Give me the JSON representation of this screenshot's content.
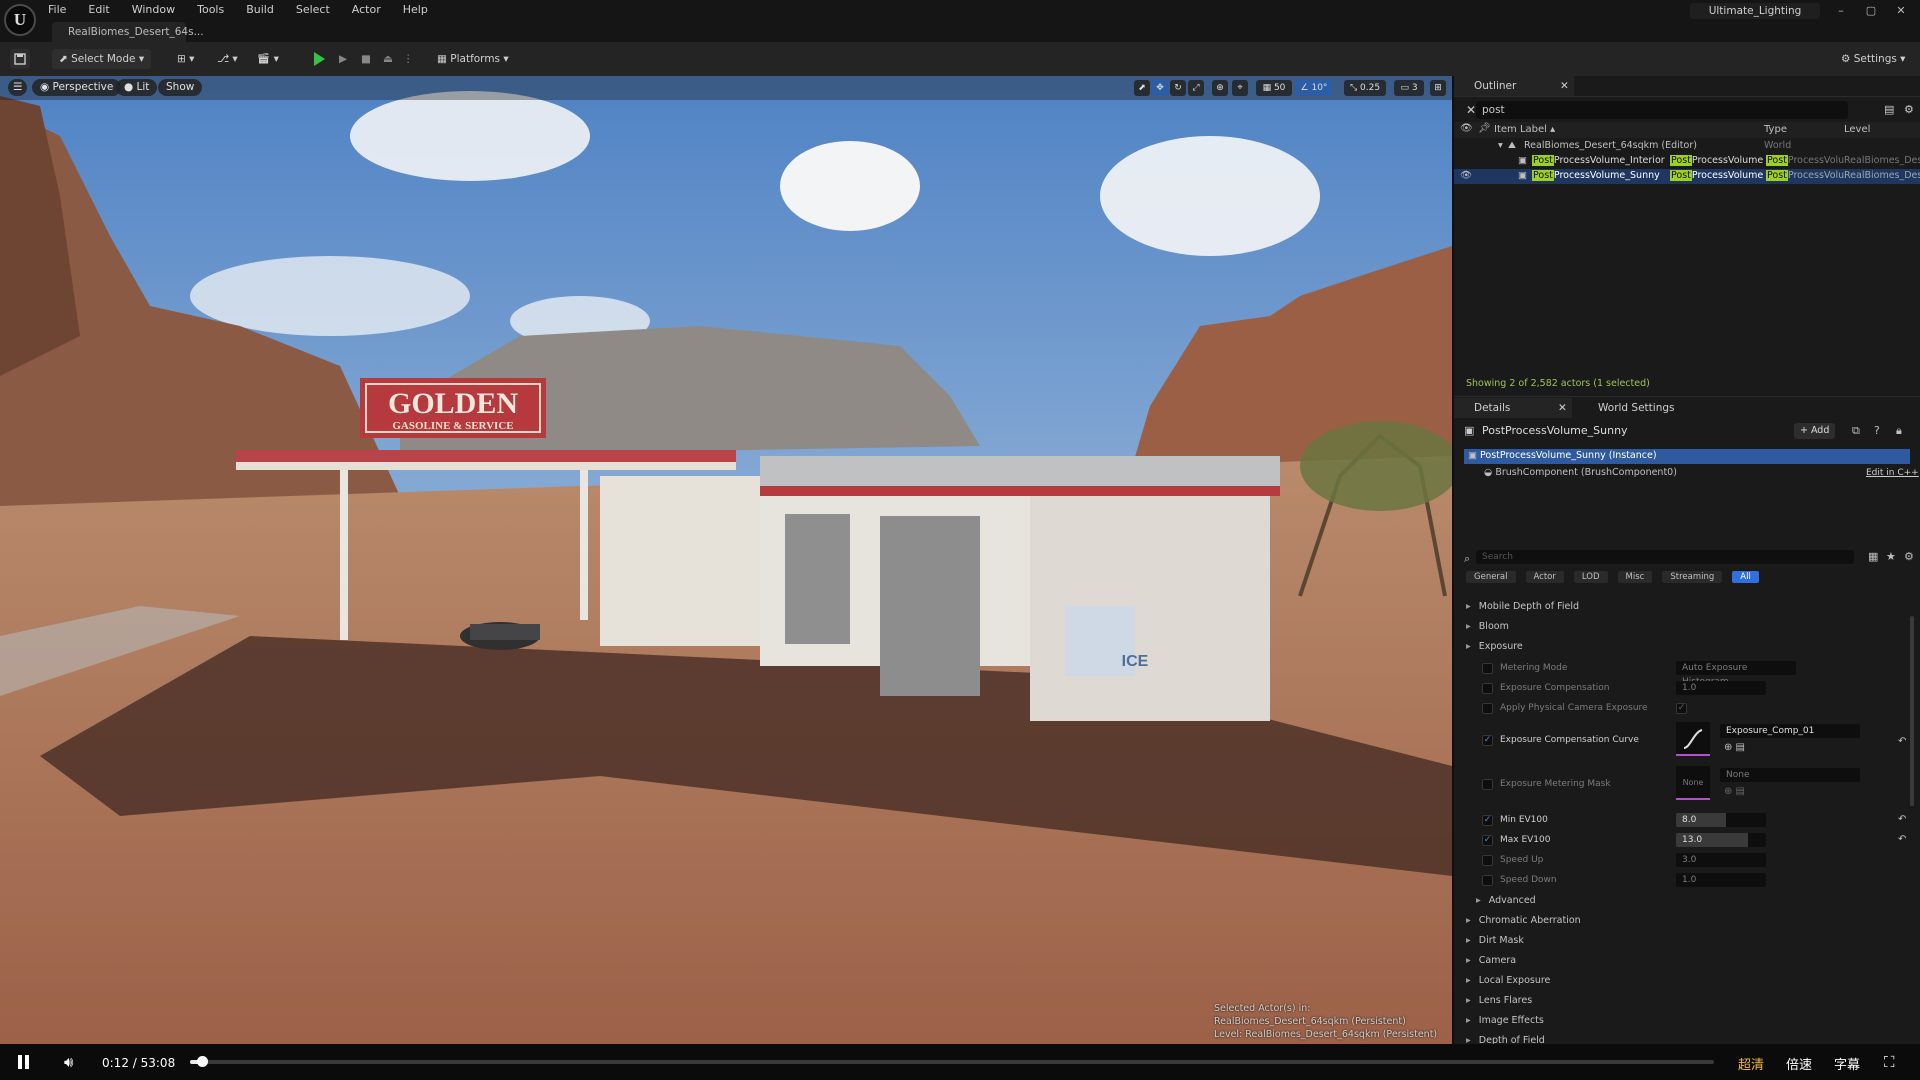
{
  "menu": [
    "File",
    "Edit",
    "Window",
    "Tools",
    "Build",
    "Select",
    "Actor",
    "Help"
  ],
  "doc_tab": "RealBiomes_Desert_64s...",
  "project_name": "Ultimate_Lighting",
  "window_controls": [
    "–",
    "▢",
    "✕"
  ],
  "toolbar": {
    "select_mode": "Select Mode",
    "platforms": "Platforms",
    "settings": "Settings"
  },
  "viewport": {
    "perspective": "Perspective",
    "lit": "Lit",
    "show": "Show",
    "grid_snap": "50",
    "angle_snap": "10°",
    "scale_snap": "0.25",
    "camera_speed": "3",
    "sign_title": "GOLDEN",
    "sign_sub": "GASOLINE & SERVICE",
    "ice_label": "ICE",
    "overlay_line1": "Selected Actor(s) in:",
    "overlay_line2": "RealBiomes_Desert_64sqkm (Persistent)",
    "overlay_line3": "Level: RealBiomes_Desert_64sqkm (Persistent)"
  },
  "outliner": {
    "title": "Outliner",
    "search_value": "post",
    "columns": {
      "label": "Item Label ▴",
      "type": "Type",
      "level": "Level"
    },
    "world": {
      "name": "RealBiomes_Desert_64sqkm (Editor)",
      "type": "World"
    },
    "rows": [
      {
        "hl": "Post",
        "name": "ProcessVolume_Interior",
        "type_hl": "Post",
        "type": "ProcessVolume",
        "type2_hl": "Post",
        "type2": "ProcessVolu",
        "level": "RealBiomes_Des"
      },
      {
        "hl": "Post",
        "name": "ProcessVolume_Sunny",
        "type_hl": "Post",
        "type": "ProcessVolume",
        "type2_hl": "Post",
        "type2": "ProcessVolu",
        "level": "RealBiomes_Des"
      }
    ],
    "status": "Showing 2 of 2,582 actors (1 selected)"
  },
  "details": {
    "tab": "Details",
    "world_settings_tab": "World Settings",
    "actor_name": "PostProcessVolume_Sunny",
    "add_button": "+ Add",
    "instance": "PostProcessVolume_Sunny (Instance)",
    "brush": "BrushComponent (BrushComponent0)",
    "edit_cpp": "Edit in C++",
    "search_placeholder": "Search",
    "filter_tabs": [
      "General",
      "Actor",
      "LOD",
      "Misc",
      "Streaming",
      "All"
    ],
    "categories_top": [
      "Mobile Depth of Field",
      "Bloom",
      "Exposure"
    ],
    "metering_mode": {
      "label": "Metering Mode",
      "value": "Auto Exposure Histogram"
    },
    "exposure_compensation": {
      "label": "Exposure Compensation",
      "value": "1.0"
    },
    "apply_physical": {
      "label": "Apply Physical Camera Exposure"
    },
    "exposure_curve": {
      "label": "Exposure Compensation Curve",
      "value": "Exposure_Comp_01"
    },
    "metering_mask": {
      "label": "Exposure Metering Mask",
      "value": "None",
      "thumb": "None"
    },
    "min_ev": {
      "label": "Min EV100",
      "value": "8.0",
      "fill": 0.55
    },
    "max_ev": {
      "label": "Max EV100",
      "value": "13.0",
      "fill": 0.8
    },
    "speed_up": {
      "label": "Speed Up",
      "value": "3.0"
    },
    "speed_down": {
      "label": "Speed Down",
      "value": "1.0"
    },
    "advanced": "Advanced",
    "categories_bottom": [
      "Chromatic Aberration",
      "Dirt Mask",
      "Camera",
      "Local Exposure",
      "Lens Flares",
      "Image Effects",
      "Depth of Field"
    ]
  },
  "video": {
    "time": "0:12 / 53:08",
    "progress": 0.008,
    "quality": "超清",
    "speed": "倍速",
    "subtitle": "字幕"
  }
}
